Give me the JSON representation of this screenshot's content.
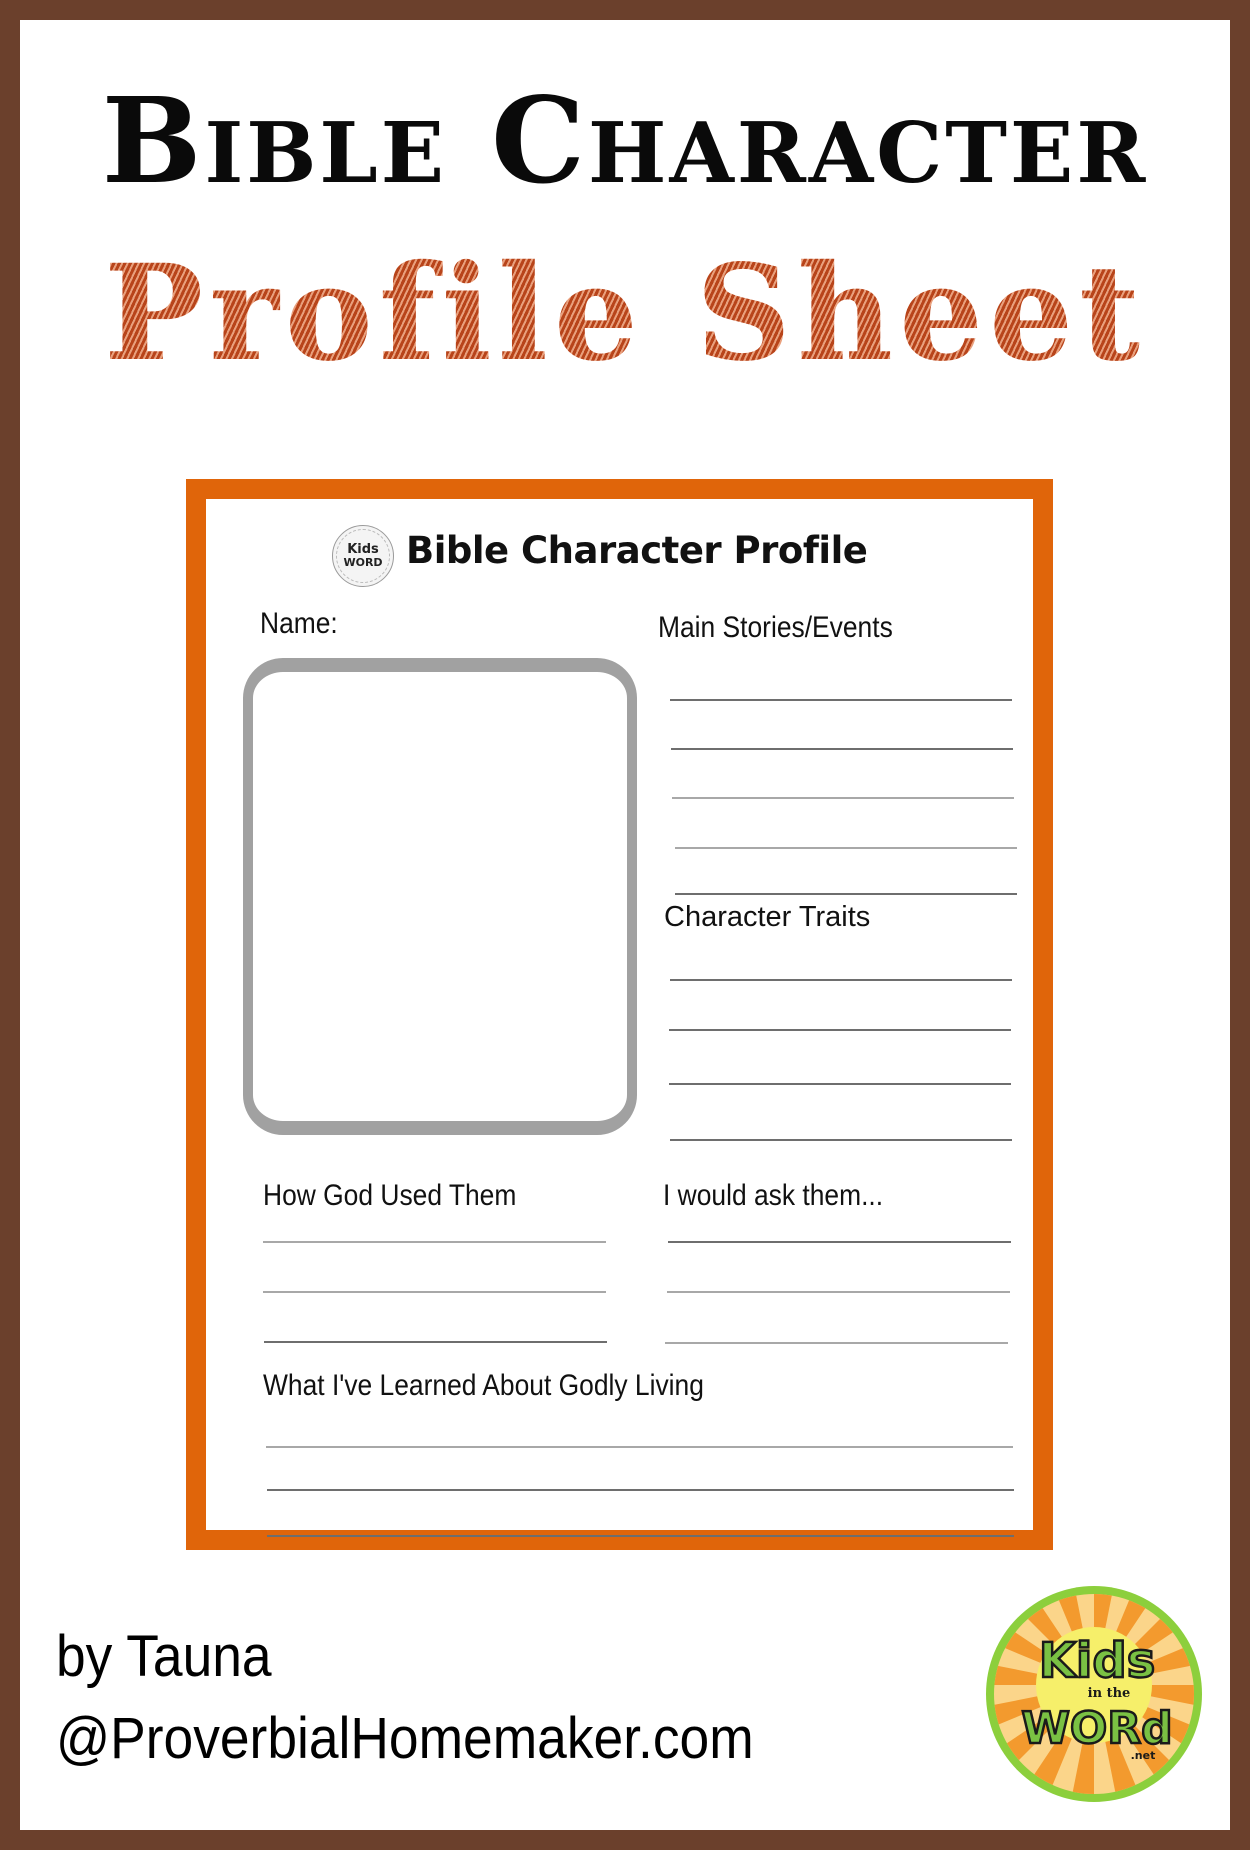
{
  "header": {
    "title_line_1": "Bible Character",
    "title_line_2": "Profile Sheet"
  },
  "colors": {
    "frame": "#6b402c",
    "card_border": "#e0650a",
    "title_accent": "#b8441a",
    "photo_border": "#a1a1a1"
  },
  "worksheet": {
    "logo_icon": "kids-in-the-word-logo-icon",
    "logo_text_top": "Kids",
    "logo_text_bottom": "WORD",
    "title": "Bible Character Profile",
    "name_label": "Name:",
    "sections": {
      "main_stories": {
        "label": "Main Stories/Events",
        "line_count": 5
      },
      "character_traits": {
        "label": "Character Traits",
        "line_count": 4
      },
      "how_god_used": {
        "label": "How God Used Them",
        "line_count": 3
      },
      "would_ask": {
        "label": "I would ask them...",
        "line_count": 3
      },
      "godly_living": {
        "label": "What I've Learned About Godly Living",
        "line_count": 3
      }
    }
  },
  "footer": {
    "byline": "by Tauna",
    "website": "@ProverbialHomemaker.com",
    "logo": {
      "icon": "kids-in-the-word-logo-icon",
      "line_1": "Kids",
      "line_2": "in the",
      "line_3": "WORd",
      "suffix": ".net"
    }
  }
}
